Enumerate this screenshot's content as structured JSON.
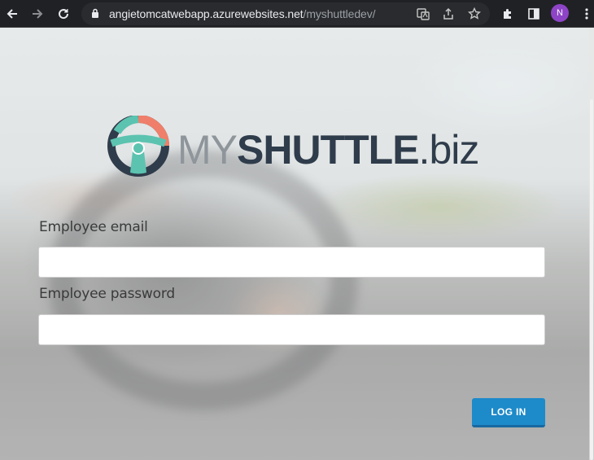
{
  "browser": {
    "url_host": "angietomcatwebapp.azurewebsites.net",
    "url_path": "/myshuttledev/",
    "profile_initial": "N"
  },
  "logo": {
    "my": "MY",
    "shuttle": "SHUTTLE",
    "biz": ".biz"
  },
  "form": {
    "email_label": "Employee email",
    "email_value": "",
    "password_label": "Employee password",
    "password_value": "",
    "login_label": "LOG IN"
  },
  "colors": {
    "accent_button": "#1d8ac9",
    "logo_dark": "#2f3c4b",
    "logo_teal": "#5cc3b0",
    "logo_coral": "#ef7f6a"
  }
}
